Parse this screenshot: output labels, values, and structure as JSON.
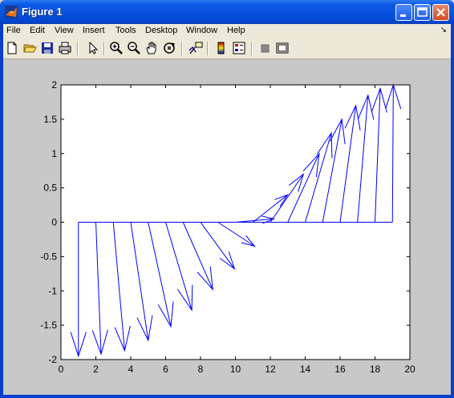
{
  "window": {
    "title": "Figure 1"
  },
  "menu": {
    "items": [
      "File",
      "Edit",
      "View",
      "Insert",
      "Tools",
      "Desktop",
      "Window",
      "Help"
    ],
    "overflow_icon": "dock-arrow-icon"
  },
  "toolbar": {
    "tools": [
      "new-figure-icon",
      "open-file-icon",
      "save-icon",
      "print-icon",
      "edit-plot-arrow-icon",
      "zoom-in-icon",
      "zoom-out-icon",
      "pan-hand-icon",
      "rotate-3d-icon",
      "data-cursor-icon",
      "colorbar-icon",
      "legend-icon",
      "hide-plot-tools-icon",
      "show-plot-tools-icon"
    ]
  },
  "colors": {
    "arrow": "#0000ff",
    "axes_bg": "#ffffff",
    "figure_bg": "#c8c8c8"
  },
  "chart_data": {
    "type": "quiver",
    "title": "",
    "xlabel": "",
    "ylabel": "",
    "xlim": [
      0,
      20
    ],
    "ylim": [
      -2,
      2
    ],
    "xticks": [
      0,
      2,
      4,
      6,
      8,
      10,
      12,
      14,
      16,
      18,
      20
    ],
    "yticks": [
      2,
      1.5,
      1,
      0.5,
      0,
      -0.5,
      -1,
      -1.5,
      -2
    ],
    "ytick_labels": [
      "2",
      "1.5",
      "1",
      "0.5",
      "0",
      "-0.5",
      "-1",
      "-1.5",
      "-2"
    ],
    "grid": false,
    "baseline": {
      "x": [
        1,
        19
      ],
      "y": 0
    },
    "arrows": [
      {
        "x": 1.0,
        "y": 0,
        "u": 0.0,
        "v": -1.95
      },
      {
        "x": 2.0,
        "y": 0,
        "u": 0.3,
        "v": -1.92
      },
      {
        "x": 3.0,
        "y": 0,
        "u": 0.65,
        "v": -1.87
      },
      {
        "x": 4.0,
        "y": 0,
        "u": 1.0,
        "v": -1.72
      },
      {
        "x": 5.0,
        "y": 0,
        "u": 1.3,
        "v": -1.52
      },
      {
        "x": 6.0,
        "y": 0,
        "u": 1.5,
        "v": -1.28
      },
      {
        "x": 7.0,
        "y": 0,
        "u": 1.7,
        "v": -0.98
      },
      {
        "x": 8.0,
        "y": 0,
        "u": 1.95,
        "v": -0.68
      },
      {
        "x": 9.0,
        "y": 0,
        "u": 2.1,
        "v": -0.35
      },
      {
        "x": 10.0,
        "y": 0,
        "u": 2.2,
        "v": 0.05
      },
      {
        "x": 11.0,
        "y": 0,
        "u": 2.0,
        "v": 0.4
      },
      {
        "x": 12.0,
        "y": 0,
        "u": 1.9,
        "v": 0.7
      },
      {
        "x": 13.0,
        "y": 0,
        "u": 1.8,
        "v": 1.0
      },
      {
        "x": 14.0,
        "y": 0,
        "u": 1.5,
        "v": 1.3
      },
      {
        "x": 15.0,
        "y": 0,
        "u": 1.1,
        "v": 1.5
      },
      {
        "x": 16.0,
        "y": 0,
        "u": 0.9,
        "v": 1.7
      },
      {
        "x": 17.0,
        "y": 0,
        "u": 0.6,
        "v": 1.85
      },
      {
        "x": 18.0,
        "y": 0,
        "u": 0.3,
        "v": 1.95
      },
      {
        "x": 19.0,
        "y": 0,
        "u": 0.05,
        "v": 2.0
      }
    ]
  }
}
